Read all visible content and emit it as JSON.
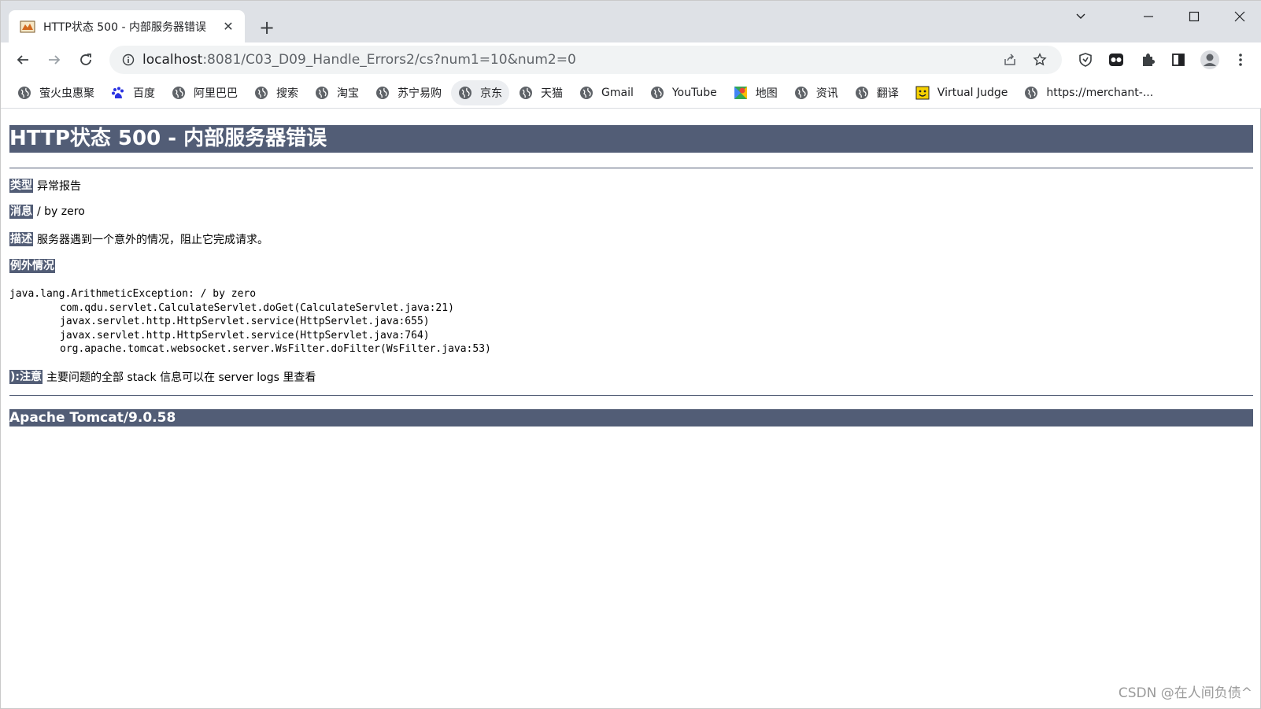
{
  "tab": {
    "title": "HTTP状态 500 - 内部服务器错误",
    "close_glyph": "✕",
    "new_tab_glyph": "+"
  },
  "toolbar": {
    "url_host": "localhost",
    "url_rest": ":8081/C03_D09_Handle_Errors2/cs?num1=10&num2=0"
  },
  "bookmarks": [
    {
      "label": "萤火虫惠聚",
      "icon": "globe-icon"
    },
    {
      "label": "百度",
      "icon": "baidu-icon"
    },
    {
      "label": "阿里巴巴",
      "icon": "globe-icon"
    },
    {
      "label": "搜索",
      "icon": "globe-icon"
    },
    {
      "label": "淘宝",
      "icon": "globe-icon"
    },
    {
      "label": "苏宁易购",
      "icon": "globe-icon"
    },
    {
      "label": "京东",
      "icon": "globe-icon"
    },
    {
      "label": "天猫",
      "icon": "globe-icon"
    },
    {
      "label": "Gmail",
      "icon": "globe-icon"
    },
    {
      "label": "YouTube",
      "icon": "globe-icon"
    },
    {
      "label": "地图",
      "icon": "maps-icon"
    },
    {
      "label": "资讯",
      "icon": "globe-icon"
    },
    {
      "label": "翻译",
      "icon": "globe-icon"
    },
    {
      "label": "Virtual Judge",
      "icon": "vjudge-icon"
    },
    {
      "label": "https://merchant-...",
      "icon": "globe-icon"
    }
  ],
  "page": {
    "heading": "HTTP状态 500 - 内部服务器错误",
    "type_label": "类型",
    "type_value": "异常报告",
    "message_label": "消息",
    "message_value": "/ by zero",
    "description_label": "描述",
    "description_value": "服务器遇到一个意外的情况，阻止它完成请求。",
    "exception_label": "例外情况",
    "stack_trace": [
      "java.lang.ArithmeticException: / by zero",
      "\tcom.qdu.servlet.CalculateServlet.doGet(CalculateServlet.java:21)",
      "\tjavax.servlet.http.HttpServlet.service(HttpServlet.java:655)",
      "\tjavax.servlet.http.HttpServlet.service(HttpServlet.java:764)",
      "\torg.apache.tomcat.websocket.server.WsFilter.doFilter(WsFilter.java:53)"
    ],
    "note_label": "):注意",
    "note_value": "主要问题的全部 stack 信息可以在 server logs 里查看",
    "footer": "Apache Tomcat/9.0.58"
  },
  "watermark": "CSDN @在人间负债^",
  "colors": {
    "tomcat_header": "#525d76",
    "tab_strip": "#dee1e6",
    "omnibox": "#f1f3f4"
  }
}
